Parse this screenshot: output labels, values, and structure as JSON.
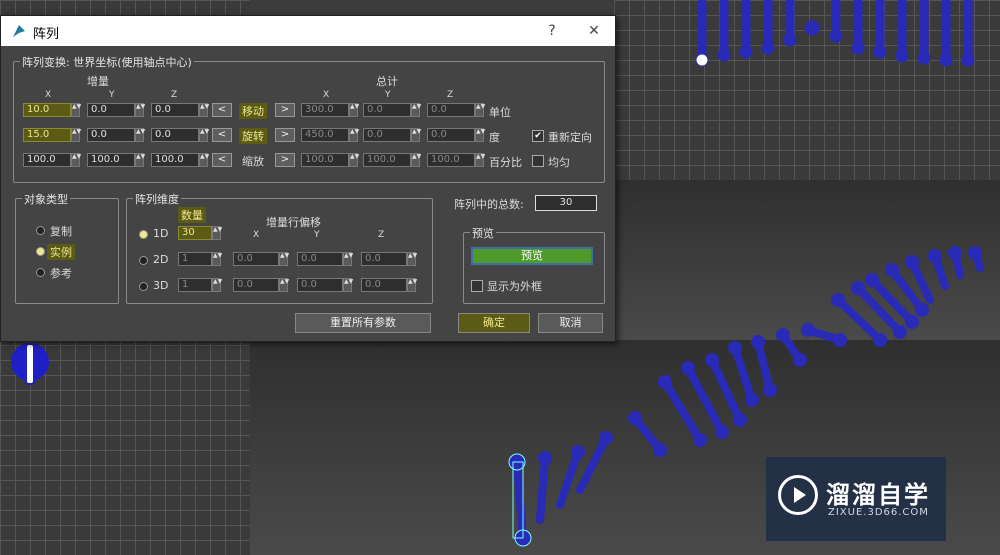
{
  "dialog": {
    "title": "阵列",
    "help_label": "?",
    "close_label": "✕",
    "transform_group": "阵列变换: 世界坐标(使用轴点中心)",
    "incremental_label": "增量",
    "totals_label": "总计",
    "axis": {
      "x": "X",
      "y": "Y",
      "z": "Z"
    },
    "move": {
      "label": "移动",
      "inc": [
        "10.0",
        "0.0",
        "0.0"
      ],
      "total": [
        "300.0",
        "0.0",
        "0.0"
      ],
      "unit": "单位"
    },
    "rotate": {
      "label": "旋转",
      "inc": [
        "15.0",
        "0.0",
        "0.0"
      ],
      "total": [
        "450.0",
        "0.0",
        "0.0"
      ],
      "unit": "度"
    },
    "scale": {
      "label": "缩放",
      "inc": [
        "100.0",
        "100.0",
        "100.0"
      ],
      "total": [
        "100.0",
        "100.0",
        "100.0"
      ],
      "unit": "百分比"
    },
    "left_arrow": "<",
    "right_arrow": ">",
    "reorient_label": "重新定向",
    "reorient_checked": "✔",
    "uniform_label": "均匀",
    "object_type_group": "对象类型",
    "copy_label": "复制",
    "instance_label": "实例",
    "reference_label": "参考",
    "dimensions_group": "阵列维度",
    "count_label": "数量",
    "incremental_row_offsets": "增量行偏移",
    "dim_1d": "1D",
    "dim_2d": "2D",
    "dim_3d": "3D",
    "count_1d": "30",
    "count_2d": "1",
    "count_3d": "1",
    "offset_2d": [
      "0.0",
      "0.0",
      "0.0"
    ],
    "offset_3d": [
      "0.0",
      "0.0",
      "0.0"
    ],
    "total_in_array_label": "阵列中的总数:",
    "total_in_array_value": "30",
    "preview_group": "预览",
    "preview_button": "预览",
    "display_as_box": "显示为外框",
    "reset_all_button": "重置所有参数",
    "ok_button": "确定",
    "cancel_button": "取消"
  },
  "logo": {
    "name": "溜溜自学",
    "url_text": "ZIXUE.3D66.COM"
  },
  "colors": {
    "helix": "#2a2ab8",
    "highlight": "#5b5b16",
    "preview_green": "#4f9a2a"
  }
}
